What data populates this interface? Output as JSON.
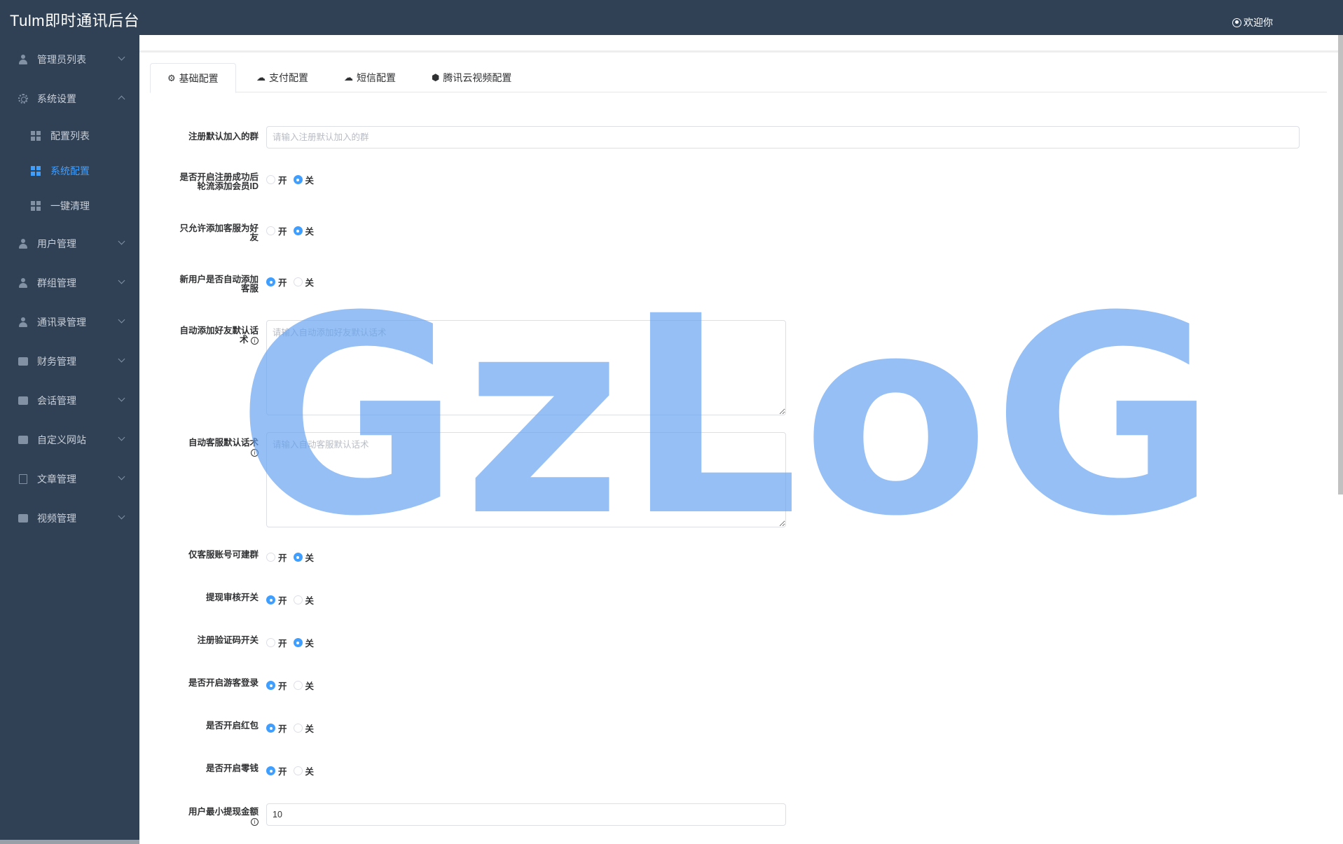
{
  "app": {
    "title": "Tulm即时通讯后台",
    "welcome": "欢迎你"
  },
  "sidebar": {
    "items": [
      {
        "label": "管理员列表",
        "icon": "person-icon"
      },
      {
        "label": "系统设置",
        "icon": "gear-icon",
        "expanded": true
      },
      {
        "label": "用户管理",
        "icon": "person-icon"
      },
      {
        "label": "群组管理",
        "icon": "group-icon"
      },
      {
        "label": "通讯录管理",
        "icon": "person-icon"
      },
      {
        "label": "财务管理",
        "icon": "wallet-icon"
      },
      {
        "label": "会话管理",
        "icon": "chat-icon"
      },
      {
        "label": "自定义网站",
        "icon": "monitor-icon"
      },
      {
        "label": "文章管理",
        "icon": "document-icon"
      },
      {
        "label": "视频管理",
        "icon": "video-icon"
      }
    ],
    "sub_items": [
      {
        "label": "配置列表",
        "active": false
      },
      {
        "label": "系统配置",
        "active": true
      },
      {
        "label": "一键清理",
        "active": false
      }
    ]
  },
  "tabs": [
    {
      "label": "基础配置",
      "icon": "gear-icon",
      "active": true
    },
    {
      "label": "支付配置",
      "icon": "cloud-upload-icon"
    },
    {
      "label": "短信配置",
      "icon": "cloud-upload-icon"
    },
    {
      "label": "腾讯云视频配置",
      "icon": "cube-icon"
    }
  ],
  "form": {
    "radio_on": "开",
    "radio_off": "关",
    "group": {
      "label": "注册默认加入的群",
      "placeholder": "请输入注册默认加入的群",
      "value": ""
    },
    "rotate_member": {
      "label1": "是否开启注册成功后",
      "label2": "轮流添加会员ID",
      "value": "关"
    },
    "only_service_friend": {
      "label1": "只允许添加客服为好",
      "label2": "友",
      "value": "关"
    },
    "auto_add_service": {
      "label1": "新用户是否自动添加",
      "label2": "客服",
      "value": "开"
    },
    "auto_friend_script": {
      "label1": "自动添加好友默认话",
      "label2": "术",
      "placeholder": "请输入自动添加好友默认话术"
    },
    "auto_service_script": {
      "label1": "自动客服默认话术",
      "placeholder": "请输入自动客服默认话术"
    },
    "service_create_group": {
      "label": "仅客服账号可建群",
      "value": "关"
    },
    "withdraw_review": {
      "label": "提现审核开关",
      "value": "开"
    },
    "register_captcha": {
      "label": "注册验证码开关",
      "value": "关"
    },
    "guest_login": {
      "label": "是否开启游客登录",
      "value": "开"
    },
    "red_packet": {
      "label": "是否开启红包",
      "value": "开"
    },
    "change": {
      "label": "是否开启零钱",
      "value": "开"
    },
    "min_withdraw": {
      "label": "用户最小提现金额",
      "value": "10"
    }
  },
  "watermark": "GzLoG",
  "colors": {
    "sidebar_bg": "#304156",
    "accent": "#409eff",
    "watermark": "#63a0f0"
  }
}
